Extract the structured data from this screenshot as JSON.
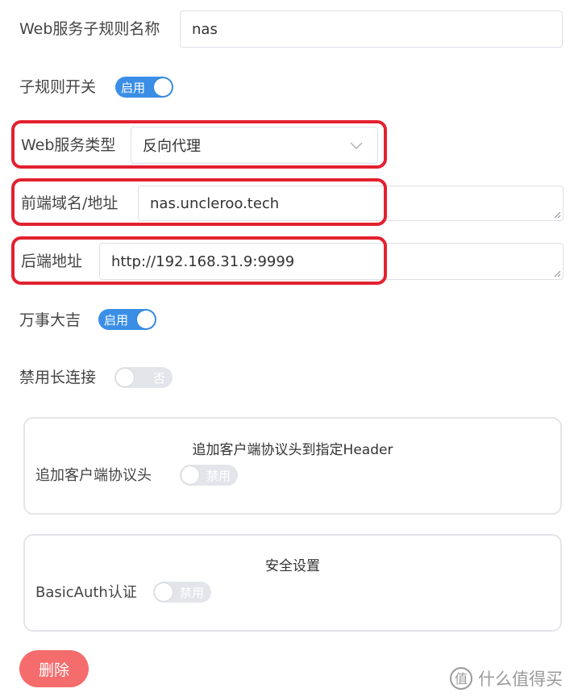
{
  "form": {
    "rule_name": {
      "label": "Web服务子规则名称",
      "value": "nas"
    },
    "rule_switch": {
      "label": "子规则开关",
      "state": "启用"
    },
    "service_type": {
      "label": "Web服务类型",
      "value": "反向代理"
    },
    "frontend": {
      "label": "前端域名/地址",
      "value": "nas.uncleroo.tech"
    },
    "backend": {
      "label": "后端地址",
      "value": "http://192.168.31.9:9999"
    },
    "wanshi": {
      "label": "万事大吉",
      "state": "启用"
    },
    "disable_keepalive": {
      "label": "禁用长连接",
      "state": "否"
    }
  },
  "header_card": {
    "title": "追加客户端协议头到指定Header",
    "label": "追加客户端协议头",
    "state": "禁用"
  },
  "security_card": {
    "title": "安全设置",
    "label": "BasicAuth认证",
    "state": "禁用"
  },
  "delete_button": "删除",
  "watermark": "什么值得买",
  "colors": {
    "switch_on": "#3a8ee6",
    "switch_off": "#e3e5ea",
    "highlight": "#e2212f",
    "danger": "#f56c6c"
  }
}
